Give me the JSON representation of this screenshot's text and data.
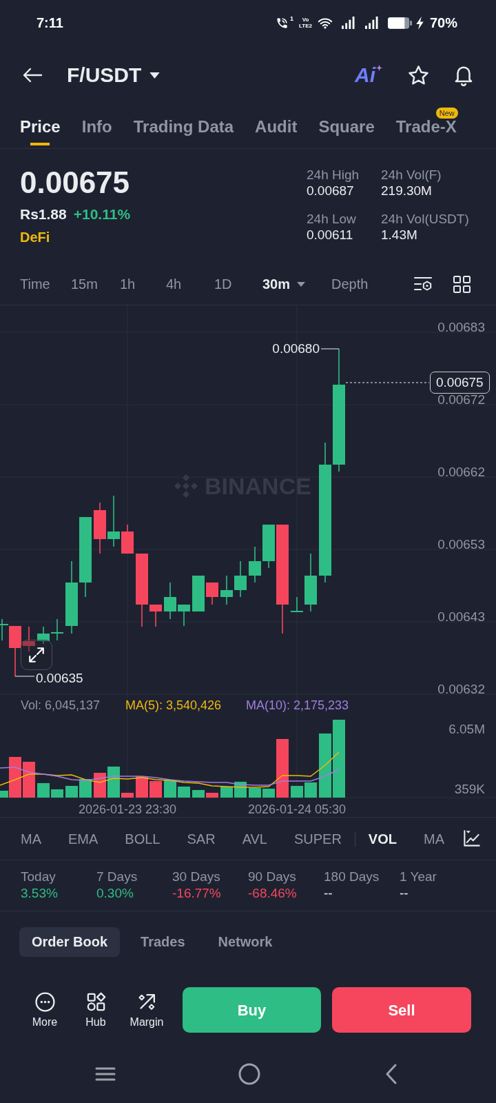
{
  "status_bar": {
    "time": "7:11",
    "sim_slot": "1",
    "volte_top": "Vo",
    "volte_bottom": "LTE2",
    "battery": "70%"
  },
  "header": {
    "pair": "F/USDT",
    "ai_label": "Ai"
  },
  "tabs": [
    {
      "label": "Price",
      "selected": true
    },
    {
      "label": "Info",
      "selected": false
    },
    {
      "label": "Trading Data",
      "selected": false
    },
    {
      "label": "Audit",
      "selected": false
    },
    {
      "label": "Square",
      "selected": false
    },
    {
      "label": "Trade-X",
      "selected": false,
      "badge": "New"
    }
  ],
  "ticker": {
    "price": "0.00675",
    "fiat_price": "Rs1.88",
    "change": "+10.11%",
    "change_rising": true,
    "sector": "DeFi",
    "stats": [
      {
        "label": "24h High",
        "value": "0.00687"
      },
      {
        "label": "24h Vol(F)",
        "value": "219.30M"
      },
      {
        "label": "24h Low",
        "value": "0.00611"
      },
      {
        "label": "24h Vol(USDT)",
        "value": "1.43M"
      }
    ]
  },
  "intervals": [
    {
      "label": "Time",
      "selected": false,
      "dropdown": false
    },
    {
      "label": "15m",
      "selected": false,
      "dropdown": false
    },
    {
      "label": "1h",
      "selected": false,
      "dropdown": false
    },
    {
      "label": "4h",
      "selected": false,
      "dropdown": false
    },
    {
      "label": "1D",
      "selected": false,
      "dropdown": false
    },
    {
      "label": "30m",
      "selected": true,
      "dropdown": true
    },
    {
      "label": "Depth",
      "selected": false,
      "dropdown": false
    }
  ],
  "chart": {
    "price_axis": [
      "0.00683",
      "0.00672",
      "0.00662",
      "0.00653",
      "0.00643",
      "0.00632"
    ],
    "high_label": "0.00680",
    "last_price": "0.00675",
    "low_label": "0.00635",
    "watermark": "BINANCE",
    "volume_legend": [
      {
        "label": "Vol: 6,045,137",
        "color": "#8f96a3"
      },
      {
        "label": "MA(5): 3,540,426",
        "color": "#f0b90b"
      },
      {
        "label": "MA(10): 2,175,233",
        "color": "#a07ee0"
      }
    ],
    "volume_axis": [
      "6.05M",
      "359K"
    ],
    "time_axis": [
      "2026-01-23 23:30",
      "2026-01-24 05:30"
    ]
  },
  "indicators": {
    "main": [
      {
        "label": "MA",
        "selected": false
      },
      {
        "label": "EMA",
        "selected": false
      },
      {
        "label": "BOLL",
        "selected": false
      },
      {
        "label": "SAR",
        "selected": false
      },
      {
        "label": "AVL",
        "selected": false
      },
      {
        "label": "SUPER",
        "selected": false
      }
    ],
    "sub": [
      {
        "label": "VOL",
        "selected": true
      },
      {
        "label": "MA",
        "selected": false
      }
    ]
  },
  "performance": [
    {
      "label": "Today",
      "value": "3.53%",
      "color": "#2ebd85"
    },
    {
      "label": "7 Days",
      "value": "0.30%",
      "color": "#2ebd85"
    },
    {
      "label": "30 Days",
      "value": "-16.77%",
      "color": "#f6465d"
    },
    {
      "label": "90 Days",
      "value": "-68.46%",
      "color": "#f6465d"
    },
    {
      "label": "180 Days",
      "value": "--",
      "color": "#eaecef"
    },
    {
      "label": "1 Year",
      "value": "--",
      "color": "#eaecef"
    }
  ],
  "panel_tabs": [
    {
      "label": "Order Book",
      "selected": true
    },
    {
      "label": "Trades",
      "selected": false
    },
    {
      "label": "Network",
      "selected": false
    }
  ],
  "actions": [
    {
      "label": "More"
    },
    {
      "label": "Hub"
    },
    {
      "label": "Margin"
    }
  ],
  "trade_buttons": {
    "buy": "Buy",
    "sell": "Sell"
  }
}
